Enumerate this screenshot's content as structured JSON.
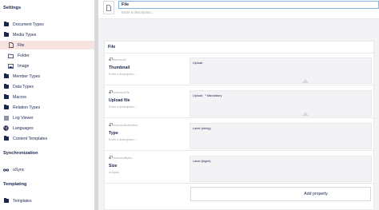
{
  "sidebar": {
    "settings_title": "Settings",
    "settings_items": [
      {
        "label": "Document Types",
        "icon": "folder-icon"
      },
      {
        "label": "Media Types",
        "icon": "folder-icon"
      },
      {
        "label": "File",
        "icon": "document-icon"
      },
      {
        "label": "Folder",
        "icon": "folder-icon"
      },
      {
        "label": "Image",
        "icon": "image-icon"
      },
      {
        "label": "Member Types",
        "icon": "folder-icon"
      },
      {
        "label": "Data Types",
        "icon": "folder-icon"
      },
      {
        "label": "Macros",
        "icon": "folder-icon"
      },
      {
        "label": "Relation Types",
        "icon": "folder-icon"
      },
      {
        "label": "Log Viewer",
        "icon": "list-icon"
      },
      {
        "label": "Languages",
        "icon": "globe-icon"
      },
      {
        "label": "Content Templates",
        "icon": "folder-icon"
      }
    ],
    "sync_title": "Synchronization",
    "sync_items": [
      {
        "label": "uSync",
        "icon": "infinity-icon"
      }
    ],
    "templating_title": "Templating",
    "templating_items": [
      {
        "label": "Templates",
        "icon": "folder-icon"
      }
    ]
  },
  "header": {
    "name_value": "File",
    "description_placeholder": "Enter a description..."
  },
  "group": {
    "title": "File",
    "properties": [
      {
        "alias": "thumbnail",
        "name": "Thumbnail",
        "description": "Enter a description...",
        "editor": "Upload",
        "mandatory": ""
      },
      {
        "alias": "umbracoFile",
        "name": "Upload file",
        "description": "Enter a description...",
        "editor": "Upload",
        "mandatory": "* Mandatory"
      },
      {
        "alias": "umbracoExtension",
        "name": "Type",
        "description": "Enter a description...",
        "editor": "Label (string)",
        "mandatory": ""
      },
      {
        "alias": "umbracoBytes",
        "name": "Size",
        "description": "in bytes",
        "editor": "Label (bigint)",
        "mandatory": ""
      }
    ],
    "add_property_label": "Add property"
  },
  "colors": {
    "active_item_bg": "#f7e3e0",
    "text_dark": "#1b264f",
    "muted_text": "#a2a1a6",
    "input_focus_border": "#7fb2e5"
  }
}
